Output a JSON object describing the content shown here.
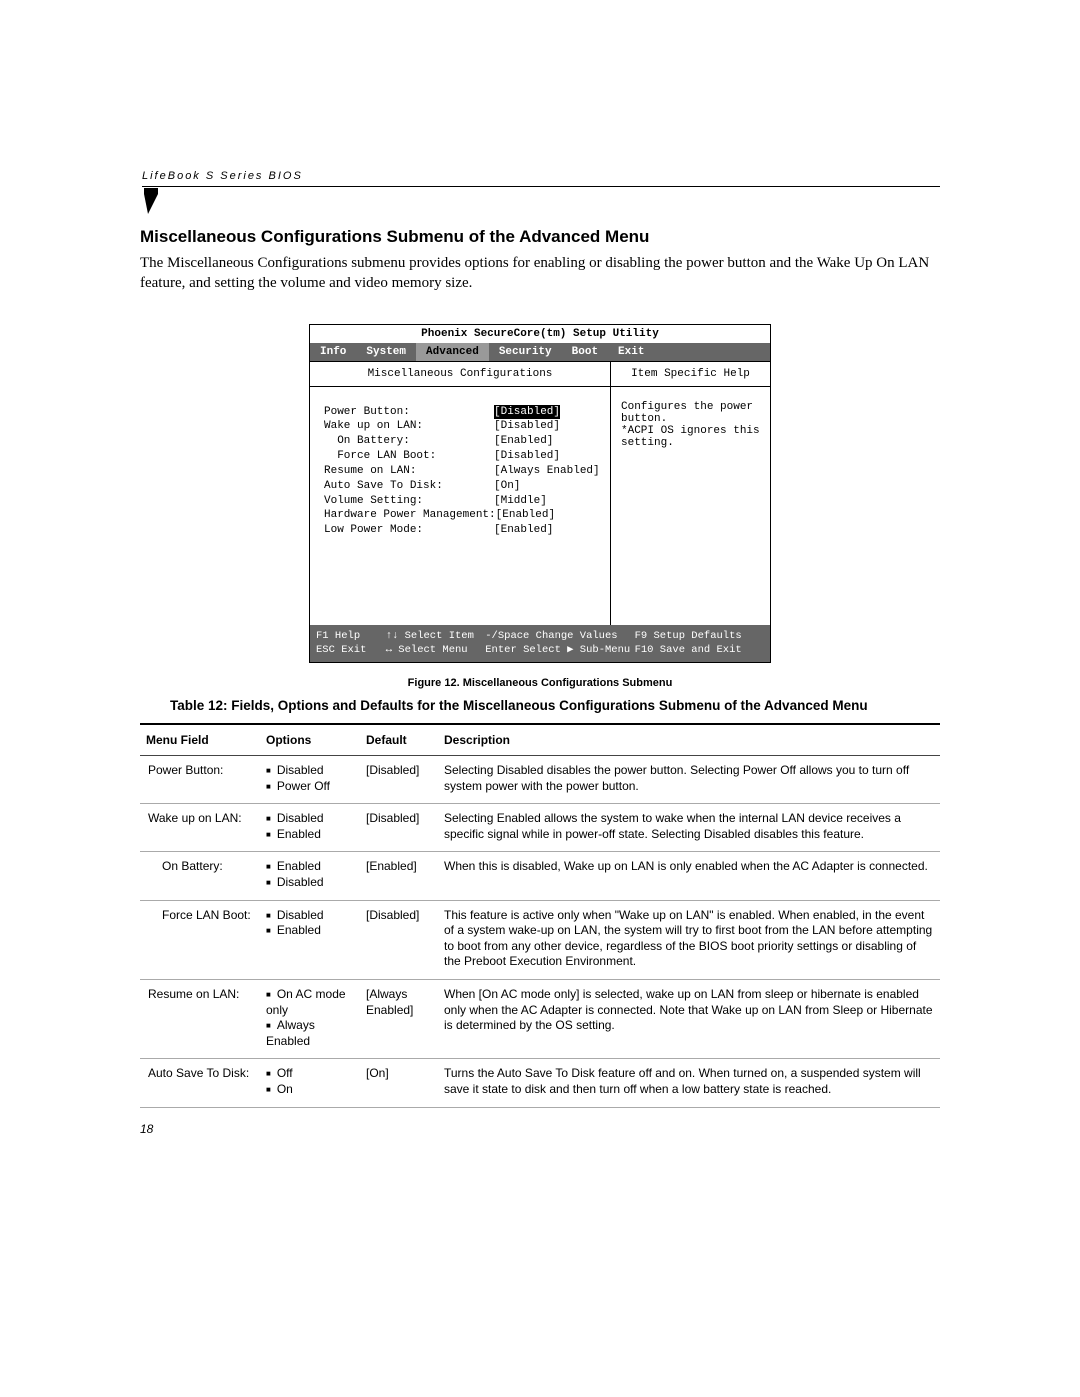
{
  "running_header": "LifeBook  S  Series  BIOS",
  "section_title": "Miscellaneous Configurations Submenu of the Advanced Menu",
  "intro": "The Miscellaneous Configurations submenu provides options for enabling or disabling the power button and the Wake Up On LAN feature, and setting the volume and video memory size.",
  "bios": {
    "title": "Phoenix SecureCore(tm) Setup Utility",
    "tabs": [
      "Info",
      "System",
      "Advanced",
      "Security",
      "Boot",
      "Exit"
    ],
    "active_tab": "Advanced",
    "submenu_title": "Miscellaneous Configurations",
    "panel_title": "Item Specific Help",
    "rows": [
      {
        "label": "Power Button:",
        "value": "[Disabled]",
        "indent": 0,
        "selected": true
      },
      {
        "label": "Wake up on LAN:",
        "value": "[Disabled]",
        "indent": 0
      },
      {
        "label": "On Battery:",
        "value": "[Enabled]",
        "indent": 1
      },
      {
        "label": "Force LAN Boot:",
        "value": "[Disabled]",
        "indent": 1
      },
      {
        "label": "Resume on LAN:",
        "value": "[Always Enabled]",
        "indent": 0
      },
      {
        "label": "Auto Save To Disk:",
        "value": "[On]",
        "indent": 0
      },
      {
        "label": "Volume Setting:",
        "value": "[Middle]",
        "indent": 0
      },
      {
        "label": "Hardware Power Management:",
        "value": "[Enabled]",
        "indent": 0
      },
      {
        "label": "Low Power Mode:",
        "value": "[Enabled]",
        "indent": 0
      }
    ],
    "help_lines": [
      "Configures the power",
      "button.",
      "*ACPI OS ignores this",
      "setting."
    ],
    "footer": {
      "line1": [
        {
          "k": "F1",
          "t": "Help"
        },
        {
          "k": "↑↓",
          "t": "Select Item"
        },
        {
          "k": "-/Space",
          "t": "Change Values"
        },
        {
          "k": "F9",
          "t": "Setup Defaults"
        }
      ],
      "line2": [
        {
          "k": "ESC",
          "t": "Exit"
        },
        {
          "k": "↔",
          "t": "Select Menu"
        },
        {
          "k": "Enter",
          "t": "Select ▶ Sub-Menu"
        },
        {
          "k": "F10",
          "t": "Save and Exit"
        }
      ]
    }
  },
  "caption": "Figure 12.  Miscellaneous Configurations Submenu",
  "table_title": "Table 12: Fields, Options and Defaults for the Miscellaneous Configurations Submenu of the Advanced Menu",
  "table": {
    "headers": [
      "Menu Field",
      "Options",
      "Default",
      "Description"
    ],
    "rows": [
      {
        "field": "Power Button:",
        "indent": false,
        "options": [
          "Disabled",
          "Power Off"
        ],
        "default": "[Disabled]",
        "desc": "Selecting Disabled disables the power button. Selecting Power Off allows you to turn off system power with the power button."
      },
      {
        "field": "Wake up on LAN:",
        "indent": false,
        "options": [
          "Disabled",
          "Enabled"
        ],
        "default": "[Disabled]",
        "desc": "Selecting Enabled allows the system to wake when the internal LAN device receives a specific signal while in power-off state. Selecting Disabled disables this feature."
      },
      {
        "field": "On Battery:",
        "indent": true,
        "options": [
          "Enabled",
          "Disabled"
        ],
        "default": "[Enabled]",
        "desc": "When this is disabled, Wake up on LAN is only enabled when the AC Adapter is connected."
      },
      {
        "field": "Force LAN Boot:",
        "indent": true,
        "options": [
          "Disabled",
          "Enabled"
        ],
        "default": "[Disabled]",
        "desc": "This feature is active only when \"Wake up on LAN\" is enabled. When enabled, in the event of a system wake-up on LAN, the system will try to first boot from the LAN before attempting to boot from any other device, regardless of the BIOS boot priority settings or disabling of the Preboot Execution Environment."
      },
      {
        "field": "Resume on LAN:",
        "indent": false,
        "options": [
          "On AC mode only",
          "Always Enabled"
        ],
        "default": "[Always Enabled]",
        "desc": "When [On AC mode only] is selected, wake up on LAN from sleep or hibernate is enabled only when the AC Adapter is connected. Note that Wake up on LAN from Sleep or Hibernate is determined by the OS setting."
      },
      {
        "field": "Auto Save To Disk:",
        "indent": false,
        "options": [
          "Off",
          "On"
        ],
        "default": "[On]",
        "desc": "Turns the Auto Save To Disk feature off and on. When turned on, a suspended system will save it state to disk and then turn off when a low battery state is reached."
      }
    ]
  },
  "page_number": "18"
}
